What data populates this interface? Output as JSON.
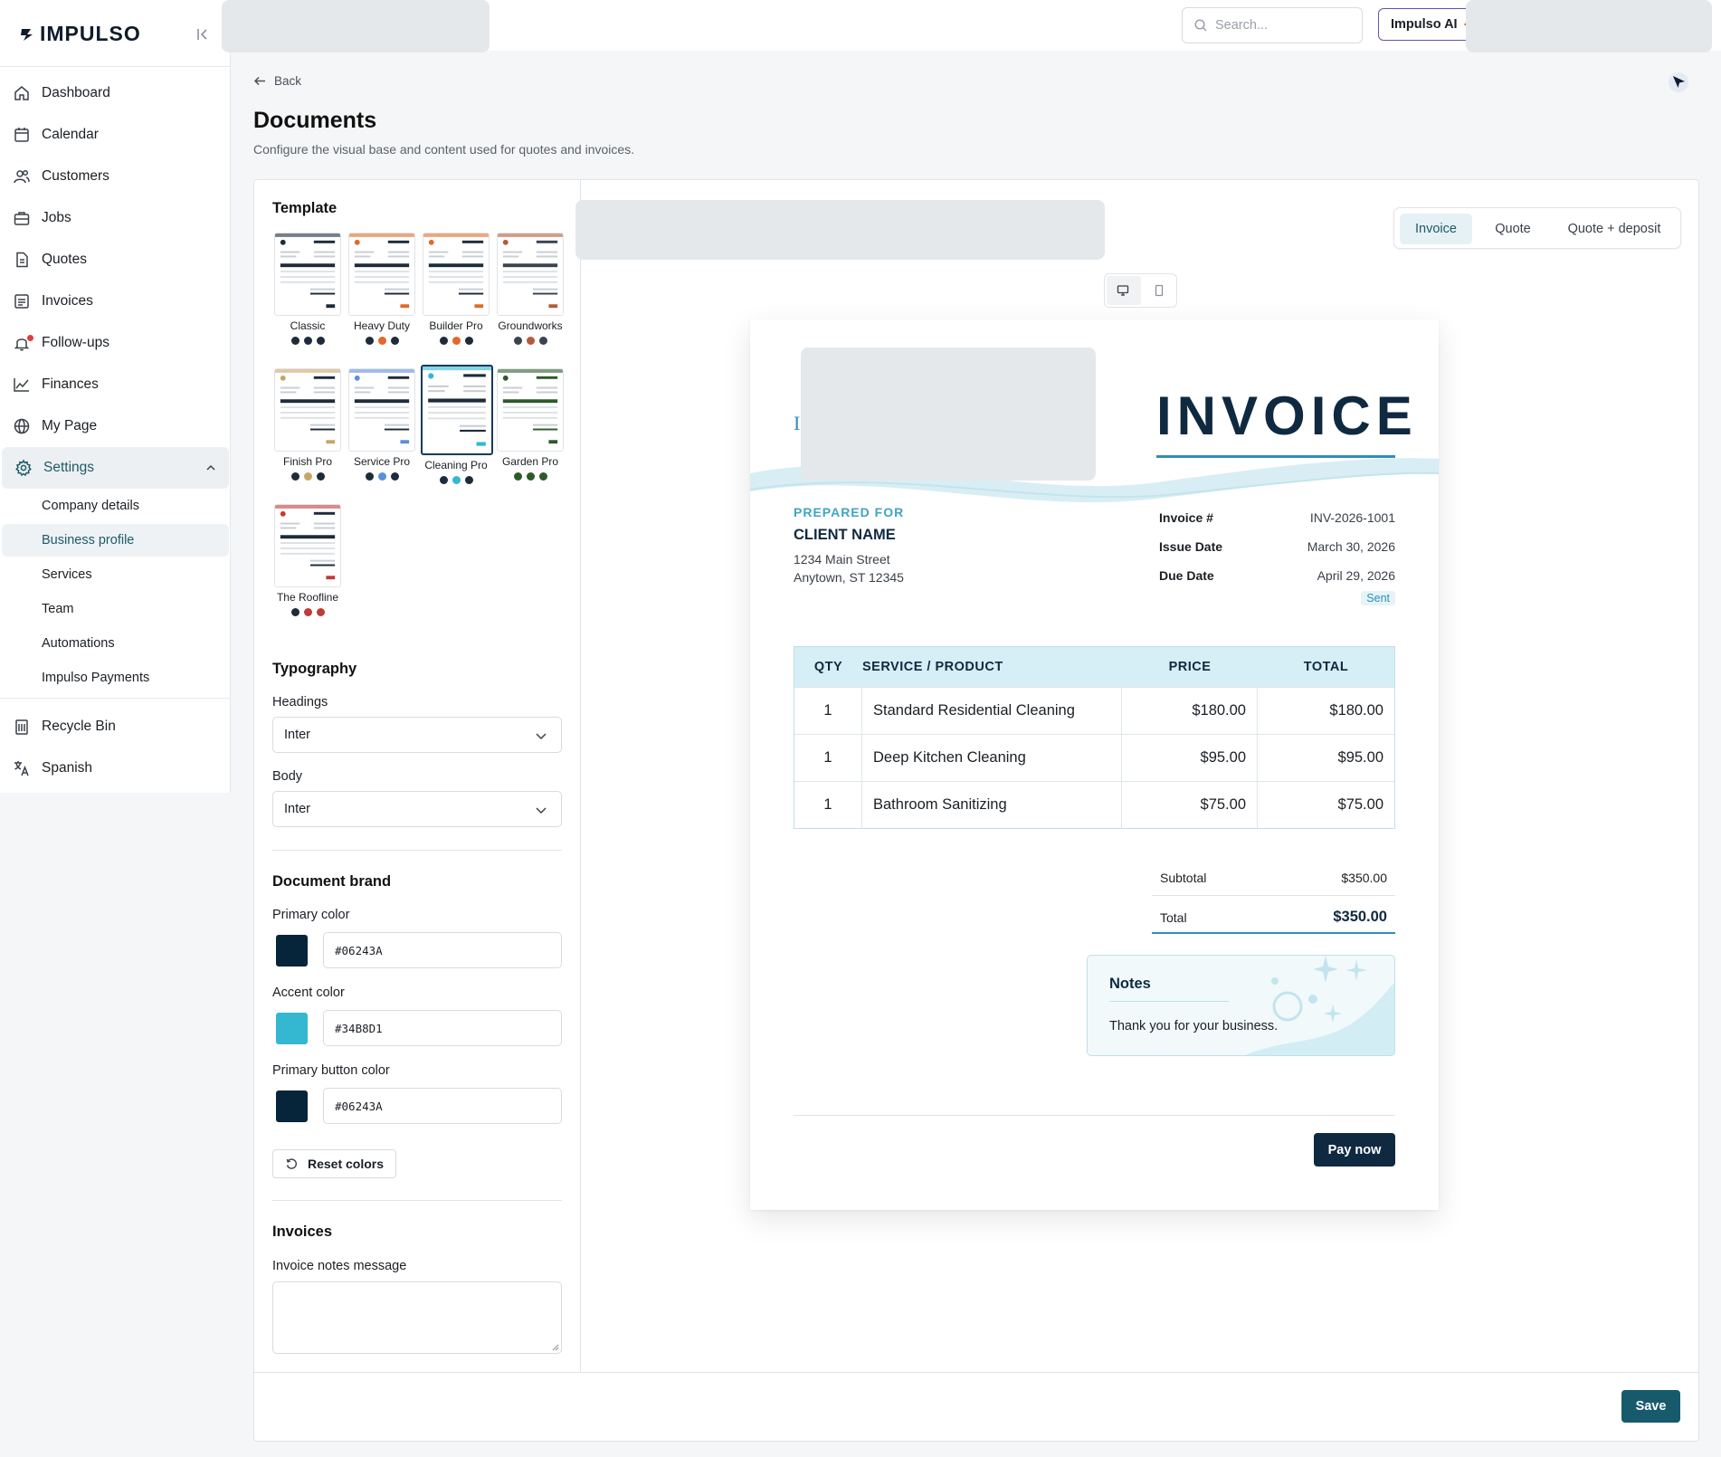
{
  "app": {
    "logo_text": "IMPULSO"
  },
  "sidebar": {
    "nav": [
      {
        "label": "Dashboard",
        "icon": "home-icon"
      },
      {
        "label": "Calendar",
        "icon": "calendar-icon"
      },
      {
        "label": "Customers",
        "icon": "users-icon"
      },
      {
        "label": "Jobs",
        "icon": "briefcase-icon"
      },
      {
        "label": "Quotes",
        "icon": "document-icon"
      },
      {
        "label": "Invoices",
        "icon": "receipt-icon"
      },
      {
        "label": "Follow-ups",
        "icon": "bell-icon"
      },
      {
        "label": "Finances",
        "icon": "chart-line-icon"
      },
      {
        "label": "My Page",
        "icon": "globe-icon"
      },
      {
        "label": "Settings",
        "icon": "gear-icon"
      }
    ],
    "settings_sub": [
      "Company details",
      "Business profile",
      "Services",
      "Team",
      "Automations",
      "Impulso Payments"
    ],
    "bottom": [
      {
        "label": "Recycle Bin",
        "icon": "trash-icon"
      },
      {
        "label": "Spanish",
        "icon": "translate-icon"
      }
    ]
  },
  "topbar": {
    "search_placeholder": "Search...",
    "ai_button": "Impulso AI"
  },
  "page": {
    "back": "Back",
    "title": "Documents",
    "subtitle": "Configure the visual base and content used for quotes and invoices."
  },
  "settings": {
    "template_title": "Template",
    "templates": [
      {
        "name": "Classic",
        "colors": [
          "#1d2b3a",
          "#1d2b3a",
          "#1d2b3a"
        ]
      },
      {
        "name": "Heavy Duty",
        "colors": [
          "#1d2b3a",
          "#e06a2a",
          "#1d2b3a"
        ]
      },
      {
        "name": "Builder Pro",
        "colors": [
          "#1d2b3a",
          "#e06a2a",
          "#1d2b3a"
        ]
      },
      {
        "name": "Groundworks",
        "colors": [
          "#3a4350",
          "#b35b3a",
          "#3a4350"
        ]
      },
      {
        "name": "Finish Pro",
        "colors": [
          "#1d2b3a",
          "#c9a46a",
          "#1d2b3a"
        ]
      },
      {
        "name": "Service Pro",
        "colors": [
          "#1d2b3a",
          "#5b8fd6",
          "#1d2b3a"
        ]
      },
      {
        "name": "Cleaning Pro",
        "colors": [
          "#1d2b3a",
          "#34b8d1",
          "#1d2b3a"
        ]
      },
      {
        "name": "Garden Pro",
        "colors": [
          "#2d5a2a",
          "#2d5a2a",
          "#2d5a2a"
        ]
      },
      {
        "name": "The Roofline",
        "colors": [
          "#1d2b3a",
          "#c23a3a",
          "#c23a3a"
        ]
      }
    ],
    "selected_template": "Cleaning Pro",
    "typography_title": "Typography",
    "headings_label": "Headings",
    "headings_value": "Inter",
    "body_label": "Body",
    "body_value": "Inter",
    "brand_title": "Document brand",
    "primary_label": "Primary color",
    "primary_value": "#06243A",
    "accent_label": "Accent color",
    "accent_value": "#34B8D1",
    "button_label": "Primary button color",
    "button_value": "#06243A",
    "reset_label": "Reset colors",
    "invoices_title": "Invoices",
    "notes_label": "Invoice notes message",
    "notes_value": "",
    "save_label": "Save"
  },
  "preview": {
    "tabs": [
      "Invoice",
      "Quote",
      "Quote + deposit"
    ],
    "active_tab": "Invoice",
    "doc": {
      "logo_letter": "I",
      "title": "INVOICE",
      "prepared_for": "PREPARED FOR",
      "client_name": "CLIENT NAME",
      "address_1": "1234 Main Street",
      "address_2": "Anytown, ST 12345",
      "meta": [
        {
          "key": "Invoice #",
          "value": "INV-2026-1001"
        },
        {
          "key": "Issue Date",
          "value": "March 30, 2026"
        },
        {
          "key": "Due Date",
          "value": "April 29, 2026"
        }
      ],
      "status": "Sent",
      "columns": [
        "QTY",
        "SERVICE / PRODUCT",
        "PRICE",
        "TOTAL"
      ],
      "rows": [
        {
          "qty": "1",
          "item": "Standard Residential Cleaning",
          "price": "$180.00",
          "total": "$180.00"
        },
        {
          "qty": "1",
          "item": "Deep Kitchen Cleaning",
          "price": "$95.00",
          "total": "$95.00"
        },
        {
          "qty": "1",
          "item": "Bathroom Sanitizing",
          "price": "$75.00",
          "total": "$75.00"
        }
      ],
      "subtotal_label": "Subtotal",
      "subtotal": "$350.00",
      "total_label": "Total",
      "total": "$350.00",
      "notes_title": "Notes",
      "notes_text": "Thank you for your business.",
      "pay_label": "Pay now"
    }
  },
  "colors": {
    "primary": "#06243A",
    "accent": "#34B8D1",
    "brand_teal": "#175a6c",
    "ai_border": "#6b4fb5"
  }
}
